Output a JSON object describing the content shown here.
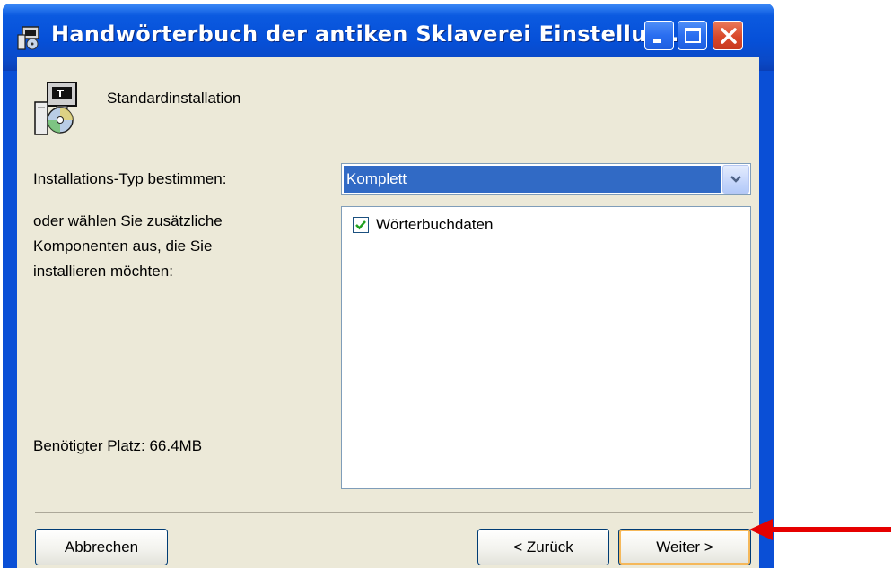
{
  "window": {
    "title": "Handwörterbuch der antiken Sklaverei  Einstellun...",
    "controls": [
      "minimize-icon",
      "maximize-icon",
      "close-icon"
    ]
  },
  "banner": {
    "icon": "installer-icon",
    "heading": "Standardinstallation"
  },
  "form": {
    "type_label": "Installations-Typ bestimmen:",
    "type_value": "Komplett",
    "components_label_lines": [
      "oder wählen Sie zusätzliche",
      "Komponenten aus, die Sie",
      "installieren möchten:"
    ],
    "components": [
      {
        "label": "Wörterbuchdaten",
        "checked": true
      }
    ],
    "space_required": "Benötigter Platz: 66.4MB"
  },
  "buttons": {
    "cancel": "Abbrechen",
    "back": "< Zurück",
    "next": "Weiter >"
  },
  "annotation": {
    "icon": "red-arrow-icon",
    "color": "#e60000"
  },
  "colors": {
    "titlebar": "#0650d8",
    "dialog_bg": "#ece9d8",
    "selection": "#316ac5",
    "close_button": "#d9482a"
  }
}
